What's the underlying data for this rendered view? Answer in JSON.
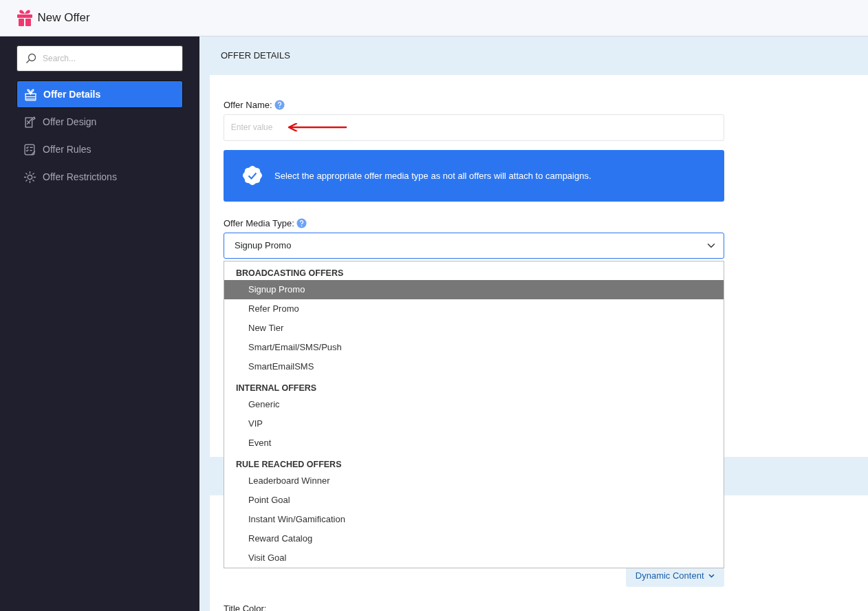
{
  "header": {
    "title": "New Offer"
  },
  "sidebar": {
    "search": {
      "placeholder": "Search..."
    },
    "items": [
      {
        "label": "Offer Details",
        "selected": true
      },
      {
        "label": "Offer Design",
        "selected": false
      },
      {
        "label": "Offer Rules",
        "selected": false
      },
      {
        "label": "Offer Restrictions",
        "selected": false
      }
    ]
  },
  "section": {
    "title": "OFFER DETAILS"
  },
  "form": {
    "offer_name": {
      "label": "Offer Name:",
      "placeholder": "Enter value"
    },
    "notice": "Select the appropriate offer media type as not all offers will attach to campaigns.",
    "media_type": {
      "label": "Offer Media Type:",
      "value": "Signup Promo",
      "expanded": true,
      "groups": [
        {
          "label": "BROADCASTING OFFERS",
          "options": [
            {
              "label": "Signup Promo",
              "selected": true
            },
            {
              "label": "Refer Promo",
              "selected": false
            },
            {
              "label": "New Tier",
              "selected": false
            },
            {
              "label": "Smart/Email/SMS/Push",
              "selected": false
            },
            {
              "label": "SmartEmailSMS",
              "selected": false
            }
          ]
        },
        {
          "label": "INTERNAL OFFERS",
          "options": [
            {
              "label": "Generic",
              "selected": false
            },
            {
              "label": "VIP",
              "selected": false
            },
            {
              "label": "Event",
              "selected": false
            }
          ]
        },
        {
          "label": "RULE REACHED OFFERS",
          "options": [
            {
              "label": "Leaderboard Winner",
              "selected": false
            },
            {
              "label": "Point Goal",
              "selected": false
            },
            {
              "label": "Instant Win/Gamification",
              "selected": false
            },
            {
              "label": "Reward Catalog",
              "selected": false
            },
            {
              "label": "Visit Goal",
              "selected": false
            }
          ]
        }
      ]
    },
    "dynamic_button": "Dynamic Content",
    "title_color_label": "Title Color:"
  }
}
